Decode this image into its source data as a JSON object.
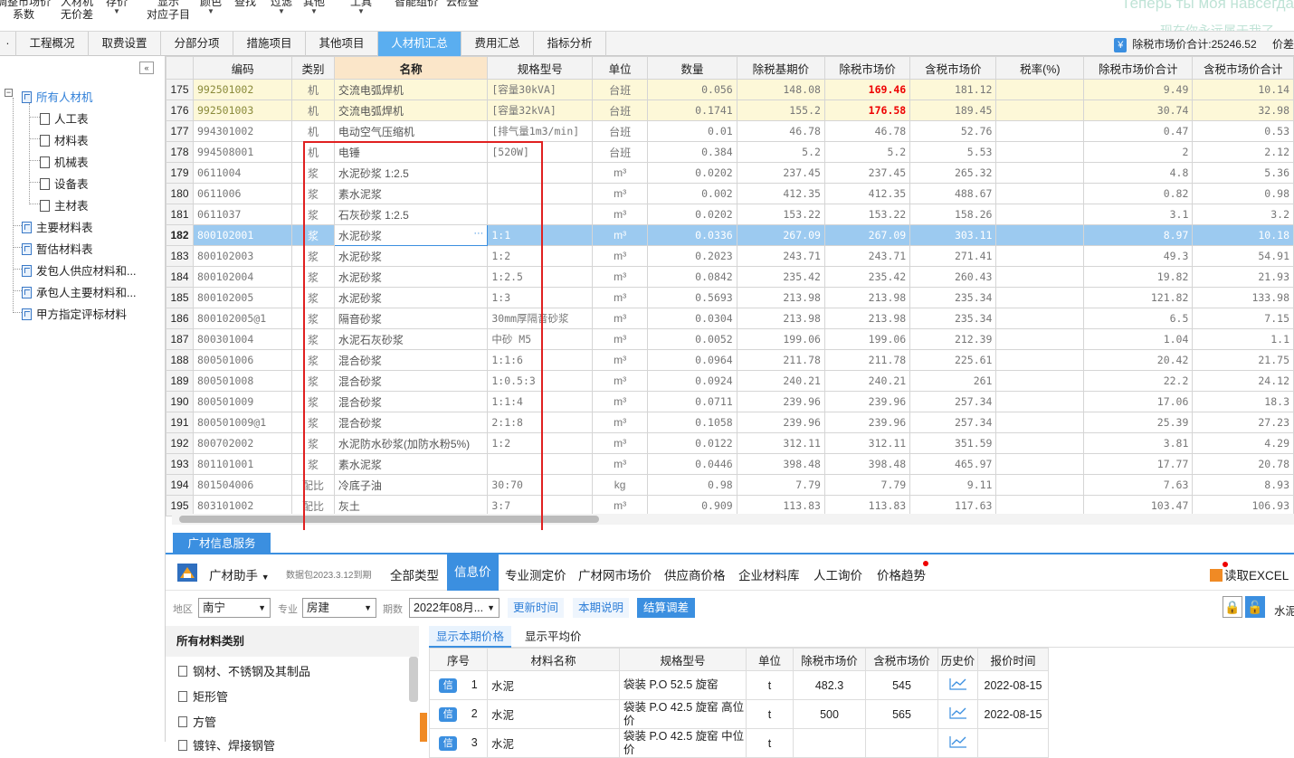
{
  "ribbon": {
    "items": [
      {
        "top": "调整市场价",
        "bottom": "系数"
      },
      {
        "top": "人材机",
        "bottom": "无价差"
      },
      {
        "top": "存价",
        "bottom": ""
      },
      {
        "top": "显示",
        "bottom": "对应子目"
      },
      {
        "top": "颜色",
        "bottom": ""
      },
      {
        "top": "查找",
        "bottom": ""
      },
      {
        "top": "过滤",
        "bottom": ""
      },
      {
        "top": "其他",
        "bottom": ""
      },
      {
        "top": "工具",
        "bottom": ""
      },
      {
        "top": "智能组价",
        "bottom": ""
      },
      {
        "top": "云检查",
        "bottom": ""
      }
    ],
    "watermark_line1": "Теперь ты моя навсегда",
    "watermark_line2": "现在你永远属于我了"
  },
  "tabs": [
    "工程概况",
    "取费设置",
    "分部分项",
    "措施项目",
    "其他项目",
    "人材机汇总",
    "费用汇总",
    "指标分析"
  ],
  "active_tab": "人材机汇总",
  "total": {
    "icon": "¥",
    "label": "除税市场价合计:25246.52",
    "extra": "价差"
  },
  "sidebar": {
    "collapse_icon": "«",
    "items": [
      {
        "label": "所有人材机",
        "level": 0,
        "selected": true
      },
      {
        "label": "人工表",
        "level": 1
      },
      {
        "label": "材料表",
        "level": 1
      },
      {
        "label": "机械表",
        "level": 1
      },
      {
        "label": "设备表",
        "level": 1
      },
      {
        "label": "主材表",
        "level": 1
      },
      {
        "label": "主要材料表",
        "level": 0
      },
      {
        "label": "暂估材料表",
        "level": 0
      },
      {
        "label": "发包人供应材料和...",
        "level": 0
      },
      {
        "label": "承包人主要材料和...",
        "level": 0
      },
      {
        "label": "甲方指定评标材料",
        "level": 0
      }
    ]
  },
  "grid": {
    "headers": [
      "",
      "编码",
      "类别",
      "名称",
      "规格型号",
      "单位",
      "数量",
      "除税基期价",
      "除税市场价",
      "含税市场价",
      "税率(%)",
      "除税市场价合计",
      "含税市场价合计"
    ],
    "rows": [
      {
        "no": "175",
        "code": "992501002",
        "type": "机",
        "name": "交流电弧焊机",
        "spec": "[容量30kVA]",
        "unit": "台班",
        "qty": "0.056",
        "base": "148.08",
        "market": "169.46",
        "taxed": "181.12",
        "rate": "",
        "sum": "9.49",
        "sum_tax": "10.14",
        "style": "yel",
        "red": true
      },
      {
        "no": "176",
        "code": "992501003",
        "type": "机",
        "name": "交流电弧焊机",
        "spec": "[容量32kVA]",
        "unit": "台班",
        "qty": "0.1741",
        "base": "155.2",
        "market": "176.58",
        "taxed": "189.45",
        "rate": "",
        "sum": "30.74",
        "sum_tax": "32.98",
        "style": "yel",
        "red": true
      },
      {
        "no": "177",
        "code": "994301002",
        "type": "机",
        "name": "电动空气压缩机",
        "spec": "[排气量1m3/min]",
        "unit": "台班",
        "qty": "0.01",
        "base": "46.78",
        "market": "46.78",
        "taxed": "52.76",
        "rate": "",
        "sum": "0.47",
        "sum_tax": "0.53",
        "style": ""
      },
      {
        "no": "178",
        "code": "994508001",
        "type": "机",
        "name": "电锤",
        "spec": "[520W]",
        "unit": "台班",
        "qty": "0.384",
        "base": "5.2",
        "market": "5.2",
        "taxed": "5.53",
        "rate": "",
        "sum": "2",
        "sum_tax": "2.12",
        "style": ""
      },
      {
        "no": "179",
        "code": "0611004",
        "type": "浆",
        "name": "水泥砂浆 1:2.5",
        "spec": "",
        "unit": "m³",
        "qty": "0.0202",
        "base": "237.45",
        "market": "237.45",
        "taxed": "265.32",
        "rate": "",
        "sum": "4.8",
        "sum_tax": "5.36",
        "style": ""
      },
      {
        "no": "180",
        "code": "0611006",
        "type": "浆",
        "name": "素水泥浆",
        "spec": "",
        "unit": "m³",
        "qty": "0.002",
        "base": "412.35",
        "market": "412.35",
        "taxed": "488.67",
        "rate": "",
        "sum": "0.82",
        "sum_tax": "0.98",
        "style": ""
      },
      {
        "no": "181",
        "code": "0611037",
        "type": "浆",
        "name": "石灰砂浆 1:2.5",
        "spec": "",
        "unit": "m³",
        "qty": "0.0202",
        "base": "153.22",
        "market": "153.22",
        "taxed": "158.26",
        "rate": "",
        "sum": "3.1",
        "sum_tax": "3.2",
        "style": ""
      },
      {
        "no": "182",
        "code": "800102001",
        "type": "浆",
        "name": "水泥砂浆",
        "spec": "1:1",
        "unit": "m³",
        "qty": "0.0336",
        "base": "267.09",
        "market": "267.09",
        "taxed": "303.11",
        "rate": "",
        "sum": "8.97",
        "sum_tax": "10.18",
        "style": "sel"
      },
      {
        "no": "183",
        "code": "800102003",
        "type": "浆",
        "name": "水泥砂浆",
        "spec": "1:2",
        "unit": "m³",
        "qty": "0.2023",
        "base": "243.71",
        "market": "243.71",
        "taxed": "271.41",
        "rate": "",
        "sum": "49.3",
        "sum_tax": "54.91",
        "style": ""
      },
      {
        "no": "184",
        "code": "800102004",
        "type": "浆",
        "name": "水泥砂浆",
        "spec": "1:2.5",
        "unit": "m³",
        "qty": "0.0842",
        "base": "235.42",
        "market": "235.42",
        "taxed": "260.43",
        "rate": "",
        "sum": "19.82",
        "sum_tax": "21.93",
        "style": ""
      },
      {
        "no": "185",
        "code": "800102005",
        "type": "浆",
        "name": "水泥砂浆",
        "spec": "1:3",
        "unit": "m³",
        "qty": "0.5693",
        "base": "213.98",
        "market": "213.98",
        "taxed": "235.34",
        "rate": "",
        "sum": "121.82",
        "sum_tax": "133.98",
        "style": ""
      },
      {
        "no": "186",
        "code": "800102005@1",
        "type": "浆",
        "name": "隔音砂浆",
        "spec": "30mm厚隔音砂浆",
        "unit": "m³",
        "qty": "0.0304",
        "base": "213.98",
        "market": "213.98",
        "taxed": "235.34",
        "rate": "",
        "sum": "6.5",
        "sum_tax": "7.15",
        "style": ""
      },
      {
        "no": "187",
        "code": "800301004",
        "type": "浆",
        "name": "水泥石灰砂浆",
        "spec": "中砂 M5",
        "unit": "m³",
        "qty": "0.0052",
        "base": "199.06",
        "market": "199.06",
        "taxed": "212.39",
        "rate": "",
        "sum": "1.04",
        "sum_tax": "1.1",
        "style": ""
      },
      {
        "no": "188",
        "code": "800501006",
        "type": "浆",
        "name": "混合砂浆",
        "spec": "1:1:6",
        "unit": "m³",
        "qty": "0.0964",
        "base": "211.78",
        "market": "211.78",
        "taxed": "225.61",
        "rate": "",
        "sum": "20.42",
        "sum_tax": "21.75",
        "style": ""
      },
      {
        "no": "189",
        "code": "800501008",
        "type": "浆",
        "name": "混合砂浆",
        "spec": "1:0.5:3",
        "unit": "m³",
        "qty": "0.0924",
        "base": "240.21",
        "market": "240.21",
        "taxed": "261",
        "rate": "",
        "sum": "22.2",
        "sum_tax": "24.12",
        "style": ""
      },
      {
        "no": "190",
        "code": "800501009",
        "type": "浆",
        "name": "混合砂浆",
        "spec": "1:1:4",
        "unit": "m³",
        "qty": "0.0711",
        "base": "239.96",
        "market": "239.96",
        "taxed": "257.34",
        "rate": "",
        "sum": "17.06",
        "sum_tax": "18.3",
        "style": ""
      },
      {
        "no": "191",
        "code": "800501009@1",
        "type": "浆",
        "name": "混合砂浆",
        "spec": "2:1:8",
        "unit": "m³",
        "qty": "0.1058",
        "base": "239.96",
        "market": "239.96",
        "taxed": "257.34",
        "rate": "",
        "sum": "25.39",
        "sum_tax": "27.23",
        "style": ""
      },
      {
        "no": "192",
        "code": "800702002",
        "type": "浆",
        "name": "水泥防水砂浆(加防水粉5%)",
        "spec": "1:2",
        "unit": "m³",
        "qty": "0.0122",
        "base": "312.11",
        "market": "312.11",
        "taxed": "351.59",
        "rate": "",
        "sum": "3.81",
        "sum_tax": "4.29",
        "style": ""
      },
      {
        "no": "193",
        "code": "801101001",
        "type": "浆",
        "name": "素水泥浆",
        "spec": "",
        "unit": "m³",
        "qty": "0.0446",
        "base": "398.48",
        "market": "398.48",
        "taxed": "465.97",
        "rate": "",
        "sum": "17.77",
        "sum_tax": "20.78",
        "style": ""
      },
      {
        "no": "194",
        "code": "801504006",
        "type": "配比",
        "name": "冷底子油",
        "spec": "30:70",
        "unit": "kg",
        "qty": "0.98",
        "base": "7.79",
        "market": "7.79",
        "taxed": "9.11",
        "rate": "",
        "sum": "7.63",
        "sum_tax": "8.93",
        "style": ""
      },
      {
        "no": "195",
        "code": "803101002",
        "type": "配比",
        "name": "灰土",
        "spec": "3:7",
        "unit": "m³",
        "qty": "0.909",
        "base": "113.83",
        "market": "113.83",
        "taxed": "117.63",
        "rate": "",
        "sum": "103.47",
        "sum_tax": "106.93",
        "style": ""
      }
    ],
    "ellipsis": "···"
  },
  "bottom": {
    "tab": "广材信息服务",
    "assistant": "广材助手",
    "assistant_arrow": "▼",
    "package": "数据包2023.3.12到期",
    "menu": [
      "全部类型",
      "信息价",
      "专业测定价",
      "广材网市场价",
      "供应商价格",
      "企业材料库",
      "人工询价",
      "价格趋势"
    ],
    "menu_active": "信息价",
    "excel": "读取EXCEL",
    "filters": {
      "region_label": "地区",
      "region": "南宁",
      "major_label": "专业",
      "major": "房建",
      "period_label": "期数",
      "period": "2022年08月...",
      "refresh": "更新时间",
      "note": "本期说明",
      "settle": "结算调差",
      "search_prefix": "水泥"
    },
    "categories": {
      "header": "所有材料类别",
      "items": [
        "钢材、不锈钢及其制品",
        "矩形管",
        "方管",
        "镀锌、焊接钢管"
      ]
    },
    "price_tabs": [
      "显示本期价格",
      "显示平均价"
    ],
    "price_headers": [
      "序号",
      "材料名称",
      "规格型号",
      "单位",
      "除税市场价",
      "含税市场价",
      "历史价",
      "报价时间"
    ],
    "price_rows": [
      {
        "badge": "信",
        "no": "1",
        "name": "水泥",
        "spec": "袋装 P.O 52.5 旋窑",
        "unit": "t",
        "price": "482.3",
        "price_tax": "545",
        "date": "2022-08-15"
      },
      {
        "badge": "信",
        "no": "2",
        "name": "水泥",
        "spec": "袋装 P.O 42.5 旋窑 高位价",
        "unit": "t",
        "price": "500",
        "price_tax": "565",
        "date": "2022-08-15"
      },
      {
        "badge": "信",
        "no": "3",
        "name": "水泥",
        "spec": "袋装 P.O 42.5 旋窑 中位价",
        "unit": "t",
        "price": "",
        "price_tax": "",
        "date": ""
      }
    ]
  }
}
